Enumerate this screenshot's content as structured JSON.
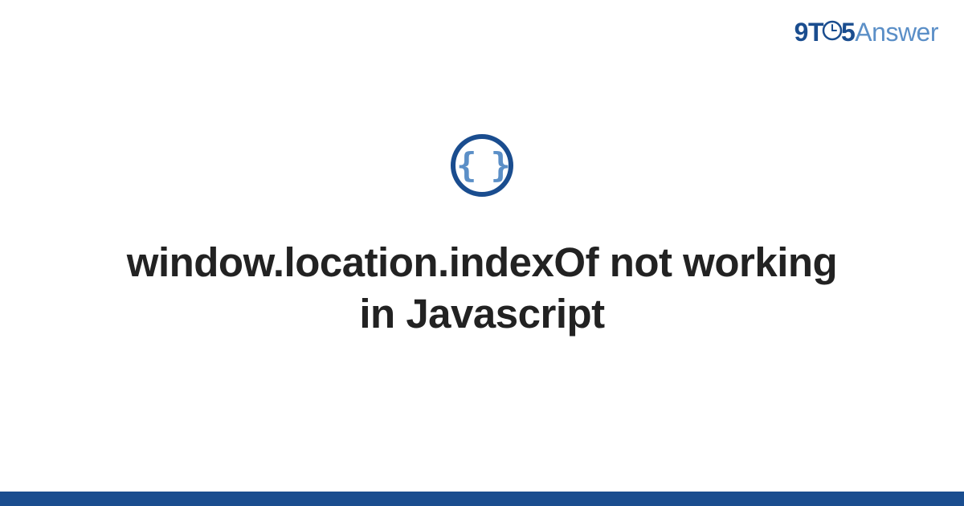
{
  "logo": {
    "part1": "9",
    "part2": "T",
    "part3": "5",
    "part4": "Answer"
  },
  "icon": {
    "content": "{ }",
    "name": "code-braces-icon"
  },
  "title": "window.location.indexOf not working in Javascript",
  "colors": {
    "brand_dark": "#1a4d8f",
    "brand_light": "#5b8fc7",
    "text": "#222222"
  }
}
